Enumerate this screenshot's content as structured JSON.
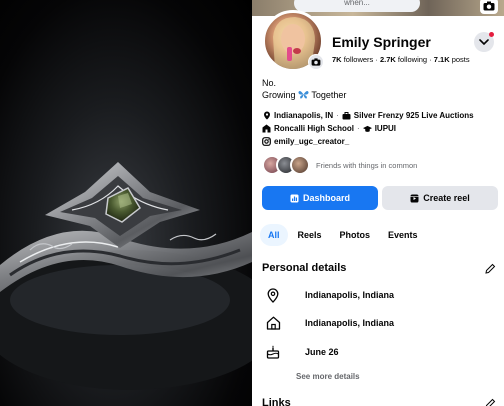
{
  "cover": {
    "pill_text": "when...",
    "camera_icon": "camera-icon"
  },
  "profile": {
    "name": "Emily Springer",
    "followers_count": "7K",
    "followers_label": "followers",
    "following_count": "2.7K",
    "following_label": "following",
    "posts_count": "7.1K",
    "posts_label": "posts",
    "bio_line1": "No.",
    "bio_line2_a": "Growing",
    "bio_line2_b": "Together"
  },
  "info": {
    "location": "Indianapolis, IN",
    "workplace": "Silver Frenzy 925 Live Auctions",
    "high_school": "Roncalli High School",
    "college": "IUPUI",
    "instagram": "emily_ugc_creator_"
  },
  "friends": {
    "text": "Friends with things in common"
  },
  "buttons": {
    "dashboard": "Dashboard",
    "create_reel": "Create reel"
  },
  "tabs": [
    "All",
    "Reels",
    "Photos",
    "Events"
  ],
  "personal_details": {
    "title": "Personal details",
    "current_city": "Indianapolis, Indiana",
    "hometown": "Indianapolis, Indiana",
    "birthday": "June 26",
    "see_more": "See more details"
  },
  "links": {
    "title": "Links"
  },
  "colors": {
    "accent": "#1877f2",
    "secondary_bg": "#e4e6eb",
    "muted_text": "#65676b",
    "notification": "#e41e3f"
  }
}
